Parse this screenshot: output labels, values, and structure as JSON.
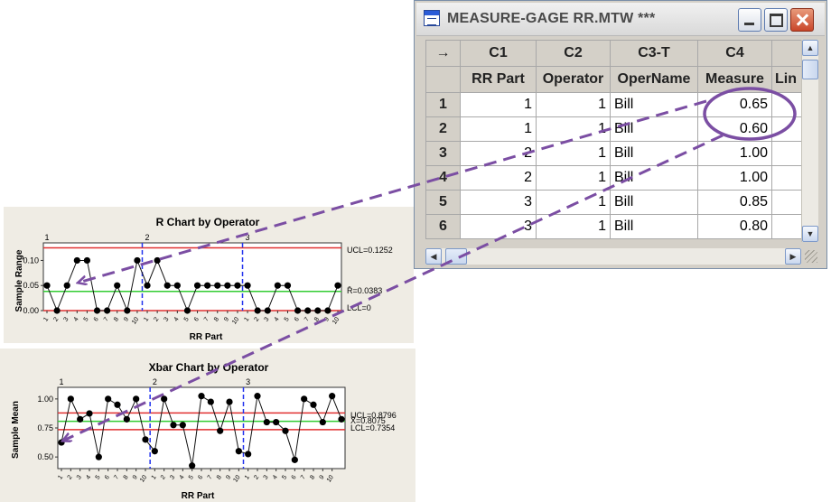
{
  "window": {
    "title": "MEASURE-GAGE RR.MTW ***",
    "columns": [
      "C1",
      "C2",
      "C3-T",
      "C4",
      ""
    ],
    "headers": [
      "RR Part",
      "Operator",
      "OperName",
      "Measure",
      "Lin"
    ],
    "corner": "→",
    "rows": [
      {
        "n": "1",
        "part": "1",
        "op": "1",
        "name": "Bill",
        "measure": "0.65"
      },
      {
        "n": "2",
        "part": "1",
        "op": "1",
        "name": "Bill",
        "measure": "0.60"
      },
      {
        "n": "3",
        "part": "2",
        "op": "1",
        "name": "Bill",
        "measure": "1.00"
      },
      {
        "n": "4",
        "part": "2",
        "op": "1",
        "name": "Bill",
        "measure": "1.00"
      },
      {
        "n": "5",
        "part": "3",
        "op": "1",
        "name": "Bill",
        "measure": "0.85"
      },
      {
        "n": "6",
        "part": "3",
        "op": "1",
        "name": "Bill",
        "measure": "0.80"
      }
    ]
  },
  "colors": {
    "ucl": "#e03030",
    "center": "#33cc33",
    "divider": "#2233ee",
    "annotation": "#7b4ea3"
  },
  "chart_data": [
    {
      "type": "line",
      "title": "R Chart by Operator",
      "xlabel": "RR Part",
      "ylabel": "Sample Range",
      "operator_labels": [
        "1",
        "2",
        "3"
      ],
      "x_ticks": [
        "1",
        "2",
        "3",
        "4",
        "5",
        "6",
        "7",
        "8",
        "9",
        "10",
        "1",
        "2",
        "3",
        "4",
        "5",
        "6",
        "7",
        "8",
        "9",
        "10",
        "1",
        "2",
        "3",
        "4",
        "5",
        "6",
        "7",
        "8",
        "9",
        "10"
      ],
      "y_ticks": [
        "0.00",
        "0.05",
        "0.10"
      ],
      "ylim": [
        0,
        0.135
      ],
      "ucl": 0.1252,
      "center": 0.0383,
      "lcl": 0,
      "ucl_label": "UCL=0.1252",
      "center_label": "R̄=0.0383",
      "lcl_label": "LCL=0",
      "values": [
        0.05,
        0.0,
        0.05,
        0.1,
        0.1,
        0.0,
        0.0,
        0.05,
        0.0,
        0.1,
        0.05,
        0.1,
        0.05,
        0.05,
        0.0,
        0.05,
        0.05,
        0.05,
        0.05,
        0.05,
        0.05,
        0.0,
        0.0,
        0.05,
        0.05,
        0.0,
        0.0,
        0.0,
        0.0,
        0.05
      ]
    },
    {
      "type": "line",
      "title": "Xbar Chart by Operator",
      "xlabel": "RR Part",
      "ylabel": "Sample Mean",
      "operator_labels": [
        "1",
        "2",
        "3"
      ],
      "x_ticks": [
        "1",
        "2",
        "3",
        "4",
        "5",
        "6",
        "7",
        "8",
        "9",
        "10",
        "1",
        "2",
        "3",
        "4",
        "5",
        "6",
        "7",
        "8",
        "9",
        "10",
        "1",
        "2",
        "3",
        "4",
        "5",
        "6",
        "7",
        "8",
        "9",
        "10"
      ],
      "y_ticks": [
        "0.50",
        "0.75",
        "1.00"
      ],
      "ylim": [
        0.4,
        1.1
      ],
      "ucl": 0.8796,
      "center": 0.8075,
      "lcl": 0.7354,
      "ucl_label": "UCL=0.8796",
      "center_label": "X̄=0.8075",
      "lcl_label": "LCL=0.7354",
      "values": [
        0.625,
        1.0,
        0.825,
        0.875,
        0.5,
        1.0,
        0.95,
        0.825,
        1.0,
        0.65,
        0.55,
        1.0,
        0.775,
        0.775,
        0.425,
        1.025,
        0.975,
        0.725,
        0.975,
        0.55,
        0.525,
        1.025,
        0.8,
        0.8,
        0.725,
        0.475,
        1.0,
        0.95,
        0.8,
        1.025,
        0.825
      ]
    }
  ]
}
